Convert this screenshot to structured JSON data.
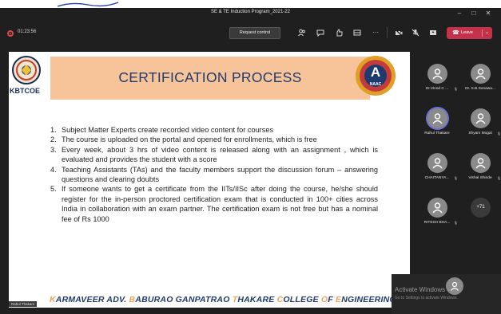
{
  "window": {
    "title": "SE & TE Induction Program_2021-22",
    "controls": {
      "minimize": "–",
      "maximize": "□",
      "close": "✕"
    }
  },
  "meeting": {
    "timer": "01:23:56",
    "request_control_label": "Request control",
    "toolbar_icons": [
      "people-icon",
      "chat-icon",
      "reactions-icon",
      "rooms-icon",
      "more-icon",
      "camera-off-icon",
      "mic-off-icon",
      "share-icon"
    ],
    "more_glyph": "···",
    "leave_label": "Leave"
  },
  "slide": {
    "title": "CERTIFICATION PROCESS",
    "left_logo_text": "KBTCOE",
    "naac_letter": "A",
    "naac_text": "NAAC",
    "points": [
      {
        "num": "1.",
        "text": "Subject Matter Experts create recorded video content for courses"
      },
      {
        "num": "2.",
        "text": "The course is uploaded on the portal and opened for enrollments, which is free"
      },
      {
        "num": "3.",
        "text": "Every week, about 3 hrs of video content is released along with an assignment , which is evaluated and provides the student with a score"
      },
      {
        "num": "4.",
        "text": "Teaching Assistants (TAs) and the faculty members support the discussion forum – answering questions and clearing doubts"
      },
      {
        "num": "5.",
        "text": "If someone wants to get a certificate from the IITs/IISc after doing the course, he/she should register for the in-person proctored certification exam that is conducted in 100+ cities across India in collaboration with an exam partner. The certification exam is not free but has a nominal fee of Rs 1000"
      }
    ],
    "footer_words": [
      {
        "cap": "K",
        "rest": "ARMAVEER ADV. "
      },
      {
        "cap": "B",
        "rest": "ABURAO GANPATRAO "
      },
      {
        "cap": "T",
        "rest": "HAKARE "
      },
      {
        "cap": "C",
        "rest": "OLLEGE "
      },
      {
        "cap": "O",
        "rest": "F "
      },
      {
        "cap": "E",
        "rest": "NGINEERING"
      }
    ],
    "presenter_tag": "Rahul Thakare"
  },
  "participants": [
    {
      "name": "Dr.Vinod C ...",
      "mic_off": true,
      "selected": false
    },
    {
      "name": "Dr. S.B.Sonawa...",
      "mic_off": false,
      "selected": false
    },
    {
      "name": "Rahul Thakare",
      "mic_off": false,
      "selected": true
    },
    {
      "name": "Shyam Mogal",
      "mic_off": true,
      "selected": false
    },
    {
      "name": "CHAITANYA...",
      "mic_off": true,
      "selected": false
    },
    {
      "name": "Vishal Shinde",
      "mic_off": true,
      "selected": false
    },
    {
      "name": "RITESH BHA...",
      "mic_off": true,
      "selected": false
    }
  ],
  "overflow_count": "+71",
  "watermark": {
    "line1": "Activate Windows",
    "line2": "Go to Settings to activate Windows."
  },
  "colors": {
    "banner": "#f7c49a",
    "title_blue": "#1f3a6e",
    "leave_red": "#c4314b",
    "accent_selected": "#6d6fd0",
    "footer_cap": "#f2a65a"
  }
}
